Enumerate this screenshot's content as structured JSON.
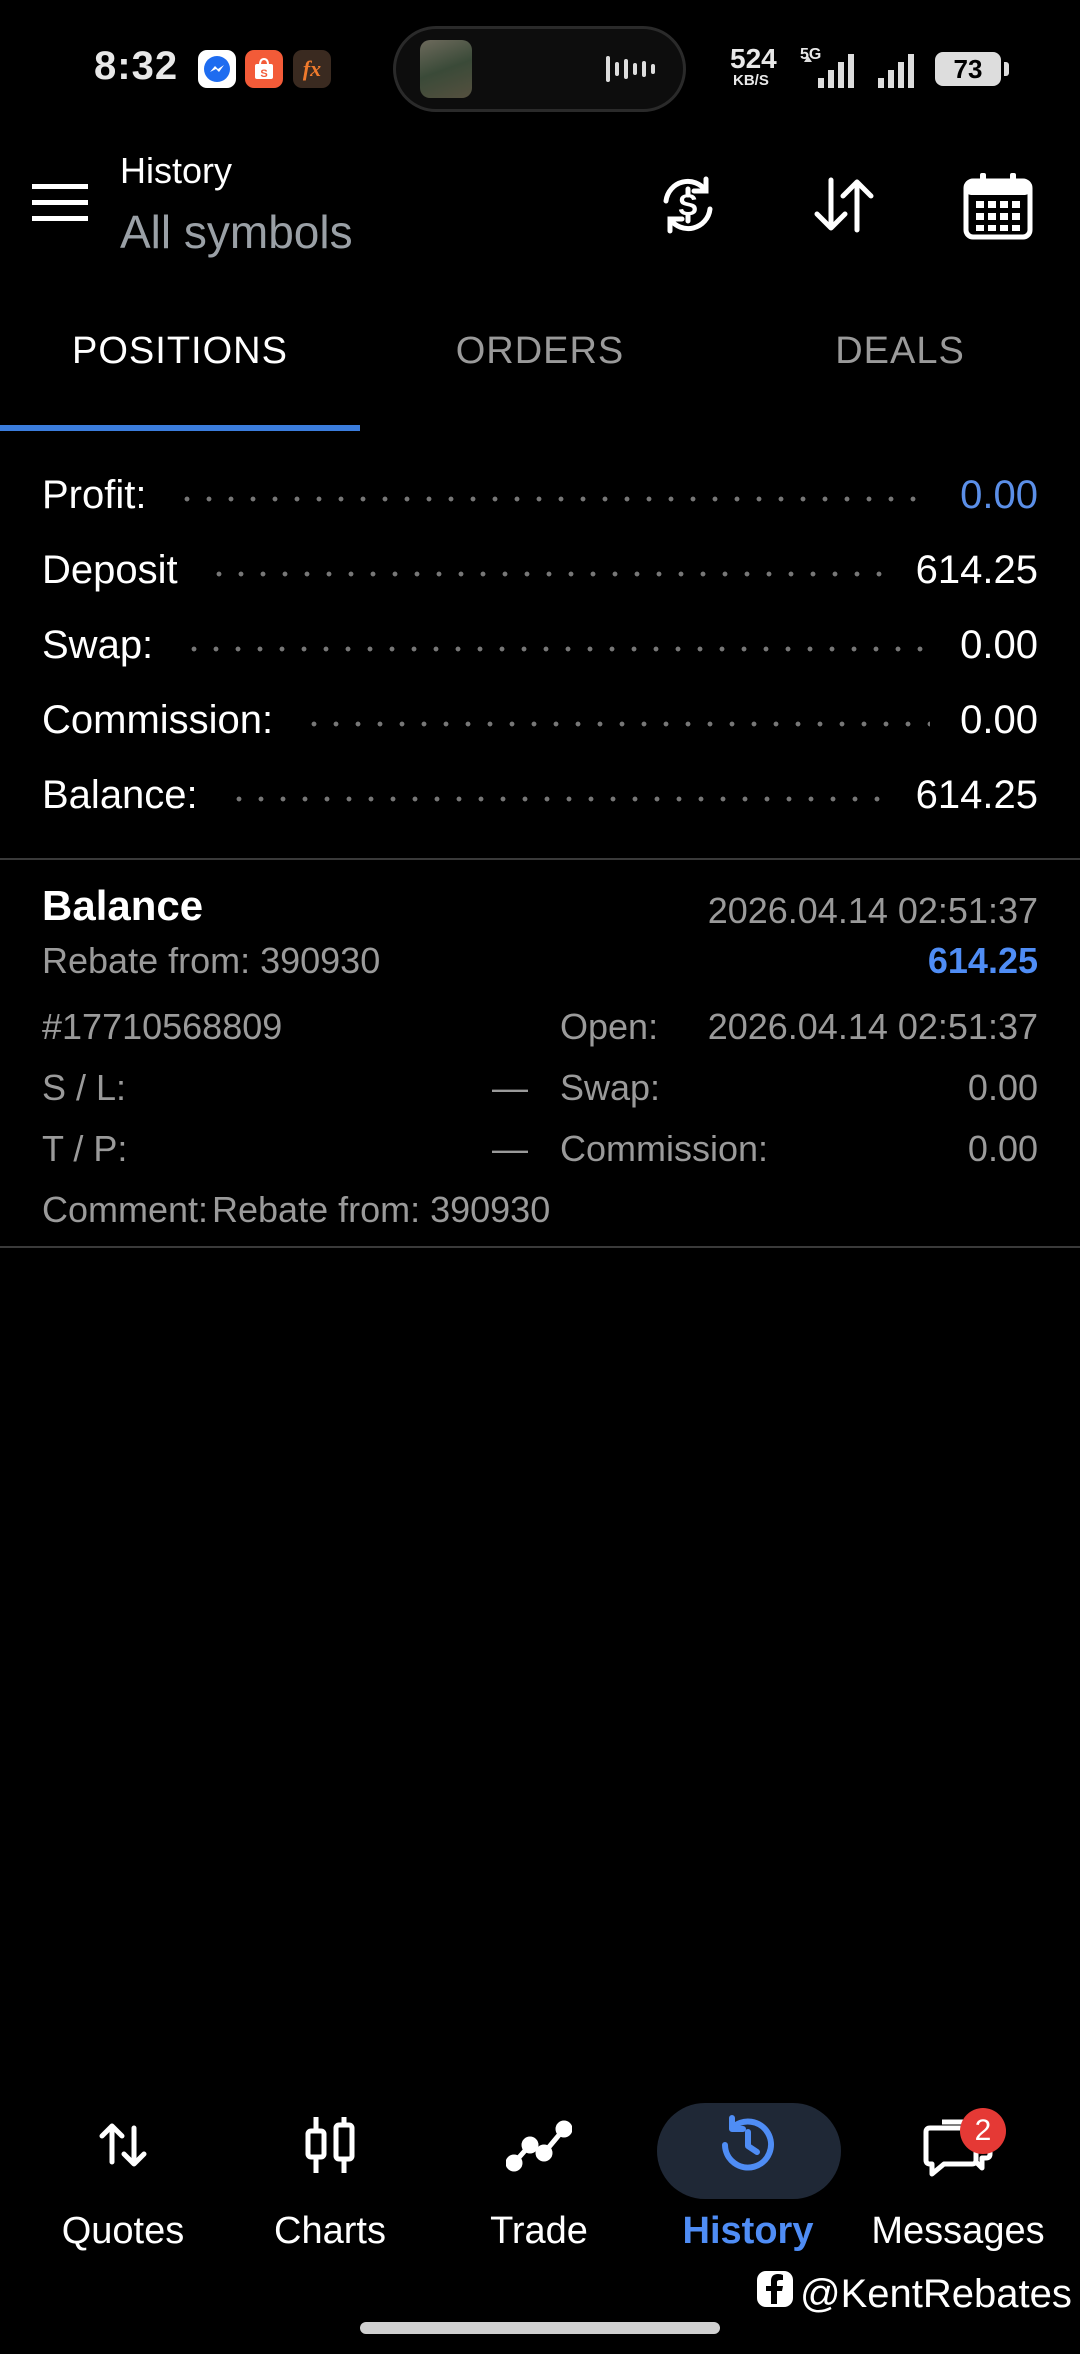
{
  "status_bar": {
    "time": "8:32",
    "net_speed_value": "524",
    "net_speed_unit": "KB/S",
    "network": "5G",
    "battery": "73"
  },
  "header": {
    "title": "History",
    "subtitle": "All symbols"
  },
  "tabs": [
    {
      "label": "POSITIONS",
      "active": true
    },
    {
      "label": "ORDERS",
      "active": false
    },
    {
      "label": "DEALS",
      "active": false
    }
  ],
  "summary": [
    {
      "label": "Profit:",
      "value": "0.00"
    },
    {
      "label": "Deposit",
      "value": "614.25"
    },
    {
      "label": "Swap:",
      "value": "0.00"
    },
    {
      "label": "Commission:",
      "value": "0.00"
    },
    {
      "label": "Balance:",
      "value": "614.25"
    }
  ],
  "entry": {
    "type": "Balance",
    "description": "Rebate from: 390930",
    "time": "2026.04.14 02:51:37",
    "amount": "614.25",
    "ticket": "#17710568809",
    "open_label": "Open:",
    "open_value": "2026.04.14 02:51:37",
    "sl_label": "S / L:",
    "sl_value": "—",
    "tp_label": "T / P:",
    "tp_value": "—",
    "swap_label": "Swap:",
    "swap_value": "0.00",
    "commission_label": "Commission:",
    "commission_value": "0.00",
    "comment_label": "Comment:",
    "comment_value": "Rebate from: 390930"
  },
  "nav": [
    {
      "label": "Quotes",
      "icon": "quotes-icon",
      "active": false
    },
    {
      "label": "Charts",
      "icon": "charts-icon",
      "active": false
    },
    {
      "label": "Trade",
      "icon": "trade-icon",
      "active": false
    },
    {
      "label": "History",
      "icon": "history-icon",
      "active": true
    },
    {
      "label": "Messages",
      "icon": "messages-icon",
      "active": false
    }
  ],
  "messages_badge": "2",
  "watermark": "@KentRebates",
  "colors": {
    "accent": "#4f8df5",
    "tab_underline": "#3b7ddd",
    "profit_value": "#5b8fe8",
    "badge": "#e53935"
  }
}
